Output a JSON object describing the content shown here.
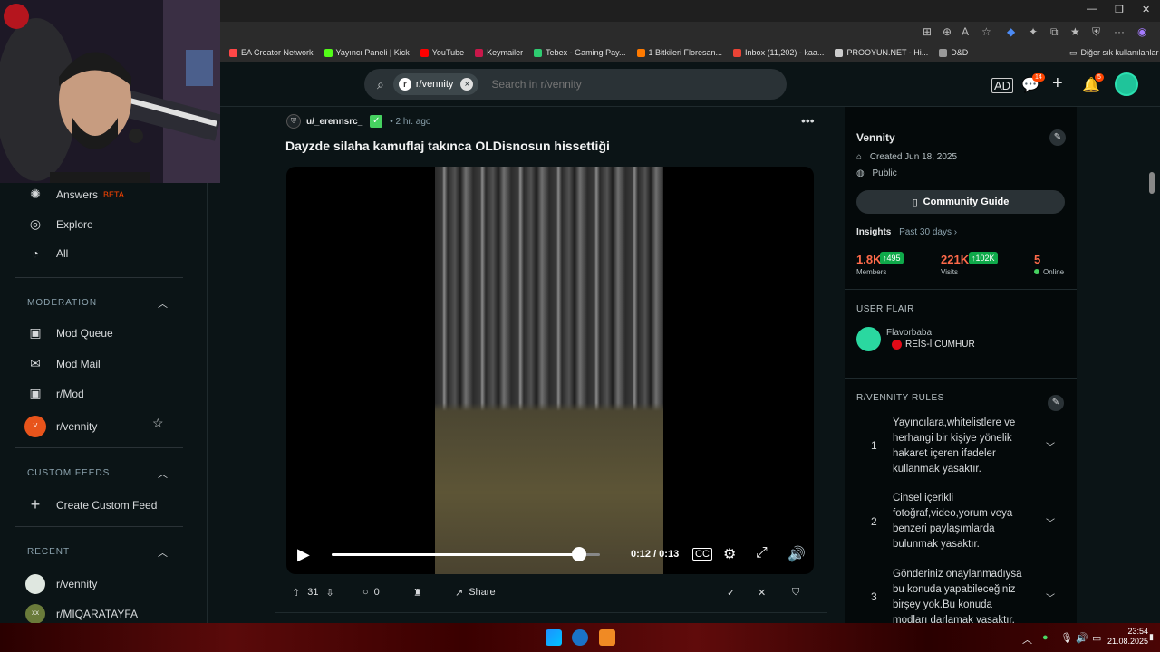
{
  "browser": {
    "bookmarks": [
      {
        "label": "EA Creator Network",
        "color": "#ff4747"
      },
      {
        "label": "Yayıncı Paneli | Kick",
        "color": "#53fc18"
      },
      {
        "label": "YouTube",
        "color": "#ff0000"
      },
      {
        "label": "Keymailer",
        "color": "#c9184a"
      },
      {
        "label": "Tebex - Gaming Pay...",
        "color": "#2ecc71"
      },
      {
        "label": "1 Bitkileri Floresan...",
        "color": "#ff7a00"
      },
      {
        "label": "Inbox (11,202) - kaa...",
        "color": "#ea4335"
      },
      {
        "label": "PROOYUN.NET - Hi...",
        "color": "#cccccc"
      },
      {
        "label": "D&D",
        "color": "#999999"
      }
    ],
    "other_bookmarks": "Diğer sık kullanılanlar"
  },
  "header": {
    "subreddit_chip": "r/vennity",
    "search_placeholder": "Search in r/vennity",
    "chat_badge": "14",
    "notif_badge": "5"
  },
  "sidebar": {
    "top_items": [
      {
        "label": "Answers",
        "badge": "BETA",
        "icon": "answers-icon"
      },
      {
        "label": "Explore",
        "icon": "explore-icon"
      },
      {
        "label": "All",
        "icon": "all-icon"
      }
    ],
    "moderation_title": "MODERATION",
    "moderation_items": [
      {
        "label": "Mod Queue",
        "icon": "mod-queue-icon"
      },
      {
        "label": "Mod Mail",
        "icon": "mod-mail-icon"
      },
      {
        "label": "r/Mod",
        "icon": "r-mod-icon"
      },
      {
        "label": "r/vennity",
        "icon": "vennity-avatar"
      }
    ],
    "custom_feeds_title": "CUSTOM FEEDS",
    "create_custom_feed": "Create Custom Feed",
    "recent_title": "RECENT",
    "recent_items": [
      {
        "label": "r/vennity"
      },
      {
        "label": "r/MIQARATAYFA"
      }
    ]
  },
  "post": {
    "author": "u/_erennsrc_",
    "time": "• 2 hr. ago",
    "title": "Dayzde silaha kamuflaj takınca OLDisnosun hissettiği",
    "video": {
      "time_display": "0:12 / 0:13",
      "progress": 0.923
    },
    "upvotes": "31",
    "comments": "0",
    "share_label": "Share"
  },
  "right_sidebar": {
    "community_name": "Vennity",
    "created": "Created Jun 18, 2025",
    "visibility": "Public",
    "community_guide": "Community Guide",
    "insights_label": "Insights",
    "insights_period": "Past 30 days",
    "stats": [
      {
        "value": "1.8K",
        "badge": "↑495",
        "label": "Members"
      },
      {
        "value": "221K",
        "badge": "↑102K",
        "label": "Visits"
      },
      {
        "value": "5",
        "label": "Online"
      }
    ],
    "user_flair_title": "USER FLAIR",
    "flair_user": "Flavorbaba",
    "flair_text": "REİS-İ CUMHUR",
    "rules_title": "R/VENNITY RULES",
    "rules": [
      {
        "num": "1",
        "text": "Yayıncılara,whitelistlere ve herhangi bir kişiye yönelik hakaret içeren ifadeler kullanmak yasaktır."
      },
      {
        "num": "2",
        "text": "Cinsel içerikli fotoğraf,video,yorum veya benzeri paylaşımlarda bulunmak yasaktır."
      },
      {
        "num": "3",
        "text": "Gönderiniz onaylanmadıysa bu konuda yapabileceğiniz birşey yok.Bu konuda modları darlamak yasaktır."
      }
    ]
  },
  "taskbar": {
    "time": "23:54",
    "date": "21.08.2025"
  }
}
